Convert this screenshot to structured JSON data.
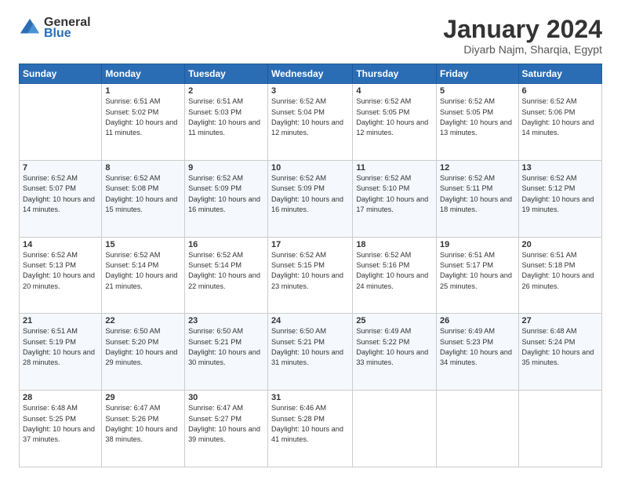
{
  "header": {
    "logo_line1": "General",
    "logo_line2": "Blue",
    "title": "January 2024",
    "subtitle": "Diyarb Najm, Sharqia, Egypt"
  },
  "columns": [
    "Sunday",
    "Monday",
    "Tuesday",
    "Wednesday",
    "Thursday",
    "Friday",
    "Saturday"
  ],
  "weeks": [
    [
      {
        "day": "",
        "sunrise": "",
        "sunset": "",
        "daylight": ""
      },
      {
        "day": "1",
        "sunrise": "Sunrise: 6:51 AM",
        "sunset": "Sunset: 5:02 PM",
        "daylight": "Daylight: 10 hours and 11 minutes."
      },
      {
        "day": "2",
        "sunrise": "Sunrise: 6:51 AM",
        "sunset": "Sunset: 5:03 PM",
        "daylight": "Daylight: 10 hours and 11 minutes."
      },
      {
        "day": "3",
        "sunrise": "Sunrise: 6:52 AM",
        "sunset": "Sunset: 5:04 PM",
        "daylight": "Daylight: 10 hours and 12 minutes."
      },
      {
        "day": "4",
        "sunrise": "Sunrise: 6:52 AM",
        "sunset": "Sunset: 5:05 PM",
        "daylight": "Daylight: 10 hours and 12 minutes."
      },
      {
        "day": "5",
        "sunrise": "Sunrise: 6:52 AM",
        "sunset": "Sunset: 5:05 PM",
        "daylight": "Daylight: 10 hours and 13 minutes."
      },
      {
        "day": "6",
        "sunrise": "Sunrise: 6:52 AM",
        "sunset": "Sunset: 5:06 PM",
        "daylight": "Daylight: 10 hours and 14 minutes."
      }
    ],
    [
      {
        "day": "7",
        "sunrise": "Sunrise: 6:52 AM",
        "sunset": "Sunset: 5:07 PM",
        "daylight": "Daylight: 10 hours and 14 minutes."
      },
      {
        "day": "8",
        "sunrise": "Sunrise: 6:52 AM",
        "sunset": "Sunset: 5:08 PM",
        "daylight": "Daylight: 10 hours and 15 minutes."
      },
      {
        "day": "9",
        "sunrise": "Sunrise: 6:52 AM",
        "sunset": "Sunset: 5:09 PM",
        "daylight": "Daylight: 10 hours and 16 minutes."
      },
      {
        "day": "10",
        "sunrise": "Sunrise: 6:52 AM",
        "sunset": "Sunset: 5:09 PM",
        "daylight": "Daylight: 10 hours and 16 minutes."
      },
      {
        "day": "11",
        "sunrise": "Sunrise: 6:52 AM",
        "sunset": "Sunset: 5:10 PM",
        "daylight": "Daylight: 10 hours and 17 minutes."
      },
      {
        "day": "12",
        "sunrise": "Sunrise: 6:52 AM",
        "sunset": "Sunset: 5:11 PM",
        "daylight": "Daylight: 10 hours and 18 minutes."
      },
      {
        "day": "13",
        "sunrise": "Sunrise: 6:52 AM",
        "sunset": "Sunset: 5:12 PM",
        "daylight": "Daylight: 10 hours and 19 minutes."
      }
    ],
    [
      {
        "day": "14",
        "sunrise": "Sunrise: 6:52 AM",
        "sunset": "Sunset: 5:13 PM",
        "daylight": "Daylight: 10 hours and 20 minutes."
      },
      {
        "day": "15",
        "sunrise": "Sunrise: 6:52 AM",
        "sunset": "Sunset: 5:14 PM",
        "daylight": "Daylight: 10 hours and 21 minutes."
      },
      {
        "day": "16",
        "sunrise": "Sunrise: 6:52 AM",
        "sunset": "Sunset: 5:14 PM",
        "daylight": "Daylight: 10 hours and 22 minutes."
      },
      {
        "day": "17",
        "sunrise": "Sunrise: 6:52 AM",
        "sunset": "Sunset: 5:15 PM",
        "daylight": "Daylight: 10 hours and 23 minutes."
      },
      {
        "day": "18",
        "sunrise": "Sunrise: 6:52 AM",
        "sunset": "Sunset: 5:16 PM",
        "daylight": "Daylight: 10 hours and 24 minutes."
      },
      {
        "day": "19",
        "sunrise": "Sunrise: 6:51 AM",
        "sunset": "Sunset: 5:17 PM",
        "daylight": "Daylight: 10 hours and 25 minutes."
      },
      {
        "day": "20",
        "sunrise": "Sunrise: 6:51 AM",
        "sunset": "Sunset: 5:18 PM",
        "daylight": "Daylight: 10 hours and 26 minutes."
      }
    ],
    [
      {
        "day": "21",
        "sunrise": "Sunrise: 6:51 AM",
        "sunset": "Sunset: 5:19 PM",
        "daylight": "Daylight: 10 hours and 28 minutes."
      },
      {
        "day": "22",
        "sunrise": "Sunrise: 6:50 AM",
        "sunset": "Sunset: 5:20 PM",
        "daylight": "Daylight: 10 hours and 29 minutes."
      },
      {
        "day": "23",
        "sunrise": "Sunrise: 6:50 AM",
        "sunset": "Sunset: 5:21 PM",
        "daylight": "Daylight: 10 hours and 30 minutes."
      },
      {
        "day": "24",
        "sunrise": "Sunrise: 6:50 AM",
        "sunset": "Sunset: 5:21 PM",
        "daylight": "Daylight: 10 hours and 31 minutes."
      },
      {
        "day": "25",
        "sunrise": "Sunrise: 6:49 AM",
        "sunset": "Sunset: 5:22 PM",
        "daylight": "Daylight: 10 hours and 33 minutes."
      },
      {
        "day": "26",
        "sunrise": "Sunrise: 6:49 AM",
        "sunset": "Sunset: 5:23 PM",
        "daylight": "Daylight: 10 hours and 34 minutes."
      },
      {
        "day": "27",
        "sunrise": "Sunrise: 6:48 AM",
        "sunset": "Sunset: 5:24 PM",
        "daylight": "Daylight: 10 hours and 35 minutes."
      }
    ],
    [
      {
        "day": "28",
        "sunrise": "Sunrise: 6:48 AM",
        "sunset": "Sunset: 5:25 PM",
        "daylight": "Daylight: 10 hours and 37 minutes."
      },
      {
        "day": "29",
        "sunrise": "Sunrise: 6:47 AM",
        "sunset": "Sunset: 5:26 PM",
        "daylight": "Daylight: 10 hours and 38 minutes."
      },
      {
        "day": "30",
        "sunrise": "Sunrise: 6:47 AM",
        "sunset": "Sunset: 5:27 PM",
        "daylight": "Daylight: 10 hours and 39 minutes."
      },
      {
        "day": "31",
        "sunrise": "Sunrise: 6:46 AM",
        "sunset": "Sunset: 5:28 PM",
        "daylight": "Daylight: 10 hours and 41 minutes."
      },
      {
        "day": "",
        "sunrise": "",
        "sunset": "",
        "daylight": ""
      },
      {
        "day": "",
        "sunrise": "",
        "sunset": "",
        "daylight": ""
      },
      {
        "day": "",
        "sunrise": "",
        "sunset": "",
        "daylight": ""
      }
    ]
  ]
}
